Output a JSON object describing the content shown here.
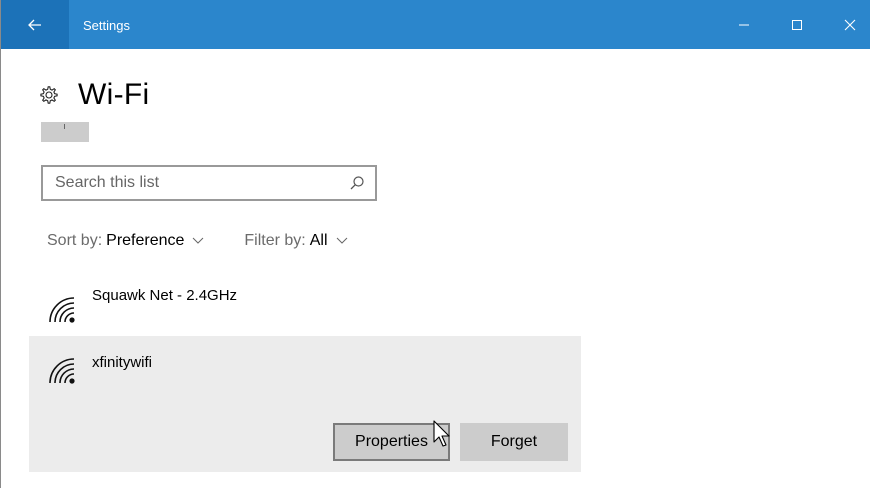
{
  "window": {
    "title": "Settings",
    "controls": [
      "minimize",
      "maximize",
      "close"
    ]
  },
  "page": {
    "title": "Wi-Fi",
    "icon": "gear-icon"
  },
  "search": {
    "placeholder": "Search this list",
    "value": ""
  },
  "sort": {
    "label": "Sort by:",
    "value": "Preference"
  },
  "filter": {
    "label": "Filter by:",
    "value": "All"
  },
  "networks": [
    {
      "name": "Squawk Net - 2.4GHz",
      "icon": "wifi-signal-icon"
    },
    {
      "name": "xfinitywifi",
      "icon": "wifi-signal-icon",
      "selected": true
    }
  ],
  "actions": {
    "properties": "Properties",
    "forget": "Forget"
  },
  "colors": {
    "titlebar": "#2b86cc",
    "back_button": "#1c72b8",
    "selected_item": "#ececec",
    "button": "#cccccc"
  }
}
